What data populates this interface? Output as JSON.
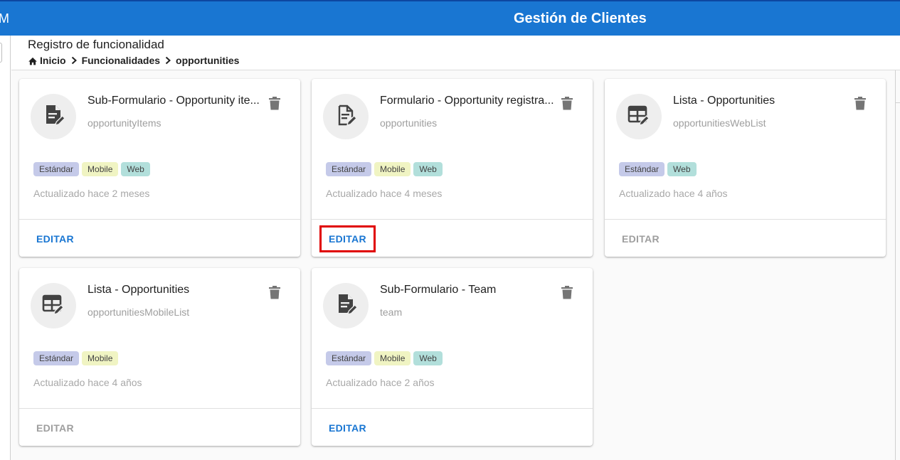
{
  "app": {
    "brand_fragment": "M",
    "title": "Gestión de Clientes"
  },
  "header": {
    "page_title": "Registro de funcionalidad",
    "breadcrumb": [
      {
        "label": "Inicio",
        "icon": "home-icon"
      },
      {
        "label": "Funcionalidades"
      },
      {
        "label": "opportunities"
      }
    ]
  },
  "colors": {
    "accent": "#1976d2",
    "chip_standard": "#c5cae9",
    "chip_mobile": "#f0f4c3",
    "chip_web": "#b2dfdb",
    "highlight": "#e00000"
  },
  "cards": [
    {
      "title": "Sub-Formulario - Opportunity ite...",
      "subtitle": "opportunityItems",
      "icon": "form-edit-icon",
      "chips": [
        "Estándar",
        "Mobile",
        "Web"
      ],
      "updated": "Actualizado hace 2 meses",
      "edit_label": "EDITAR",
      "edit_enabled": true
    },
    {
      "title": "Formulario - Opportunity registra...",
      "subtitle": "opportunities",
      "icon": "form-edit-outline-icon",
      "chips": [
        "Estándar",
        "Mobile",
        "Web"
      ],
      "updated": "Actualizado hace 4 meses",
      "edit_label": "EDITAR",
      "edit_enabled": true,
      "highlighted": true
    },
    {
      "title": "Lista - Opportunities",
      "subtitle": "opportunitiesWebList",
      "icon": "table-edit-icon",
      "chips": [
        "Estándar",
        "Web"
      ],
      "updated": "Actualizado hace 4 años",
      "edit_label": "EDITAR",
      "edit_enabled": false
    },
    {
      "title": "Lista - Opportunities",
      "subtitle": "opportunitiesMobileList",
      "icon": "table-edit-icon",
      "chips": [
        "Estándar",
        "Mobile"
      ],
      "updated": "Actualizado hace 4 años",
      "edit_label": "EDITAR",
      "edit_enabled": false
    },
    {
      "title": "Sub-Formulario - Team",
      "subtitle": "team",
      "icon": "form-edit-icon",
      "chips": [
        "Estándar",
        "Mobile",
        "Web"
      ],
      "updated": "Actualizado hace 2 años",
      "edit_label": "EDITAR",
      "edit_enabled": true
    }
  ]
}
